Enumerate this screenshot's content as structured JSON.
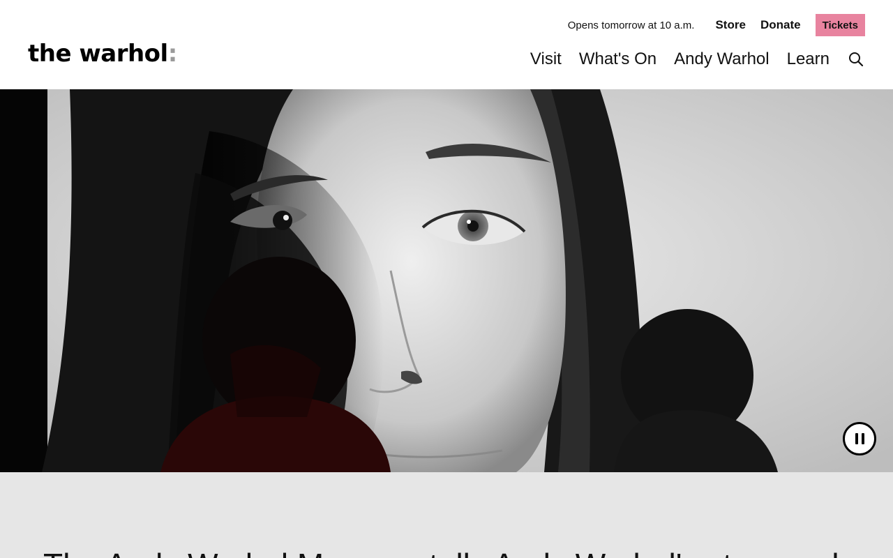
{
  "brand": {
    "name": "the warhol",
    "suffix": ":"
  },
  "utility_nav": {
    "hours": "Opens tomorrow at 10 a.m.",
    "store": "Store",
    "donate": "Donate",
    "tickets": "Tickets",
    "tickets_color": "#e8839f"
  },
  "main_nav": {
    "items": [
      {
        "label": "Visit"
      },
      {
        "label": "What's On"
      },
      {
        "label": "Andy Warhol"
      },
      {
        "label": "Learn"
      }
    ],
    "search_icon": "search-icon"
  },
  "hero": {
    "media": "black-and-white film portrait with visitor silhouettes",
    "control_icon": "pause-icon"
  },
  "intro": {
    "text": "The Andy Warhol Museum tells Andy Warhol's story and explores"
  }
}
